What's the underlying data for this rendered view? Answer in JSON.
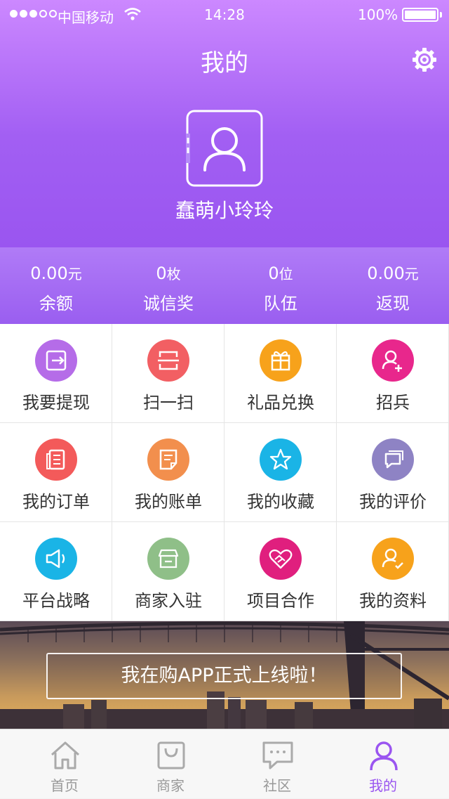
{
  "status_bar": {
    "carrier": "中国移动",
    "time": "14:28",
    "battery": "100%"
  },
  "header": {
    "title": "我的",
    "username": "蠢萌小玲玲",
    "settings_icon": "gear-icon",
    "avatar_icon": "user-avatar-icon"
  },
  "stats": [
    {
      "value": "0.00",
      "unit": "元",
      "label": "余额"
    },
    {
      "value": "0",
      "unit": "枚",
      "label": "诚信奖"
    },
    {
      "value": "0",
      "unit": "位",
      "label": "队伍"
    },
    {
      "value": "0.00",
      "unit": "元",
      "label": "返现"
    }
  ],
  "menu": [
    {
      "label": "我要提现",
      "icon": "withdraw-icon",
      "color": "#b56ce8"
    },
    {
      "label": "扫一扫",
      "icon": "scan-icon",
      "color": "#f25f63"
    },
    {
      "label": "礼品兑换",
      "icon": "gift-icon",
      "color": "#f7a21b"
    },
    {
      "label": "招兵",
      "icon": "add-user-icon",
      "color": "#e8278c"
    },
    {
      "label": "我的订单",
      "icon": "order-icon",
      "color": "#f35a5a"
    },
    {
      "label": "我的账单",
      "icon": "bill-icon",
      "color": "#f28f4d"
    },
    {
      "label": "我的收藏",
      "icon": "star-icon",
      "color": "#1ab4e6"
    },
    {
      "label": "我的评价",
      "icon": "comment-icon",
      "color": "#8e83c4"
    },
    {
      "label": "平台战略",
      "icon": "megaphone-icon",
      "color": "#1ab4e6"
    },
    {
      "label": "商家入驻",
      "icon": "store-icon",
      "color": "#8fbf88"
    },
    {
      "label": "项目合作",
      "icon": "handshake-heart-icon",
      "color": "#e01f7e"
    },
    {
      "label": "我的资料",
      "icon": "profile-check-icon",
      "color": "#f7a21b"
    }
  ],
  "banner": {
    "text": "我在购APP正式上线啦！"
  },
  "tabbar": [
    {
      "label": "首页",
      "icon": "home-icon",
      "active": false
    },
    {
      "label": "商家",
      "icon": "shopping-bag-icon",
      "active": false
    },
    {
      "label": "社区",
      "icon": "chat-icon",
      "active": false
    },
    {
      "label": "我的",
      "icon": "user-icon",
      "active": true
    }
  ],
  "colors": {
    "accent": "#9a55f0",
    "header_top": "#cc88ff",
    "inactive": "#999999"
  }
}
